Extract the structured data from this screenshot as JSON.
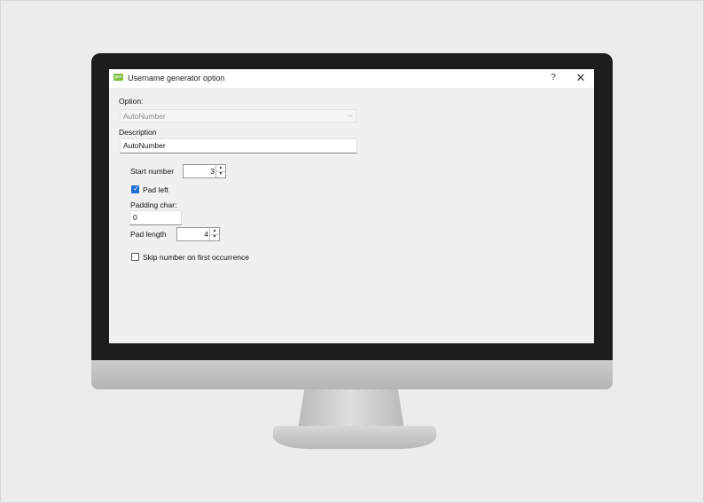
{
  "window": {
    "title": "Username generator option",
    "icon_text": "gen",
    "help_label": "?",
    "close_label": "✕",
    "accent_color": "#1e6fd0"
  },
  "form": {
    "option_label": "Option:",
    "option_value": "AutoNumber",
    "option_arrow": "⌵",
    "description_label": "Description",
    "description_value": "AutoNumber",
    "start_number_label": "Start number",
    "start_number_value": "3",
    "pad_left_label": "Pad left",
    "pad_left_checked": true,
    "padding_char_label": "Padding char:",
    "padding_char_value": "0",
    "pad_length_label": "Pad length",
    "pad_length_value": "4",
    "skip_label": "Skip number on first occurrence",
    "skip_checked": false,
    "spin_up": "▲",
    "spin_down": "▼",
    "check_glyph": "✓"
  }
}
